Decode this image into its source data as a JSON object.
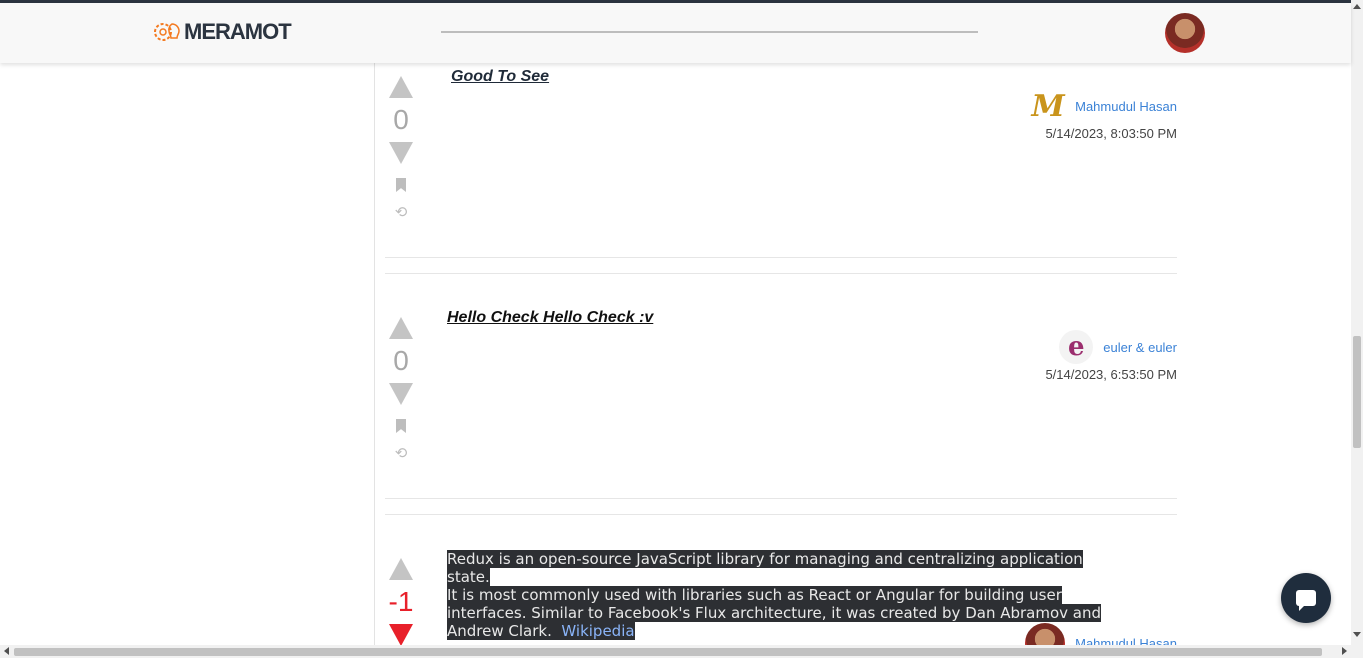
{
  "header": {
    "logo_text": "MERAMOT",
    "logo_icon": "gear-bulb-icon",
    "user_avatar": "user-avatar"
  },
  "posts": [
    {
      "title": "Good To See",
      "score": "0",
      "author": "Mahmudul Hasan",
      "author_avatar_letter": "M",
      "date": "5/14/2023, 8:03:50 PM"
    },
    {
      "title": "Hello Check Hello Check :v",
      "score": "0",
      "author": "euler & euler",
      "author_avatar_letter": "e",
      "date": "5/14/2023, 6:53:50 PM"
    },
    {
      "score": "-1",
      "body_line1": "Redux is an open-source JavaScript library for managing and centralizing application state.",
      "body_line2": "It is most commonly used with libraries such as React or Angular for building user",
      "body_line3": "interfaces. Similar to Facebook's Flux architecture, it was created by Dan Abramov and",
      "body_line4": "Andrew Clark.",
      "body_link": "Wikipedia",
      "author": "Mahmudul Hasan"
    }
  ],
  "colors": {
    "accent": "#3b82d6",
    "negative": "#e8202a",
    "navbar": "#f8f8f8",
    "chat_button": "#1f2d3d"
  }
}
